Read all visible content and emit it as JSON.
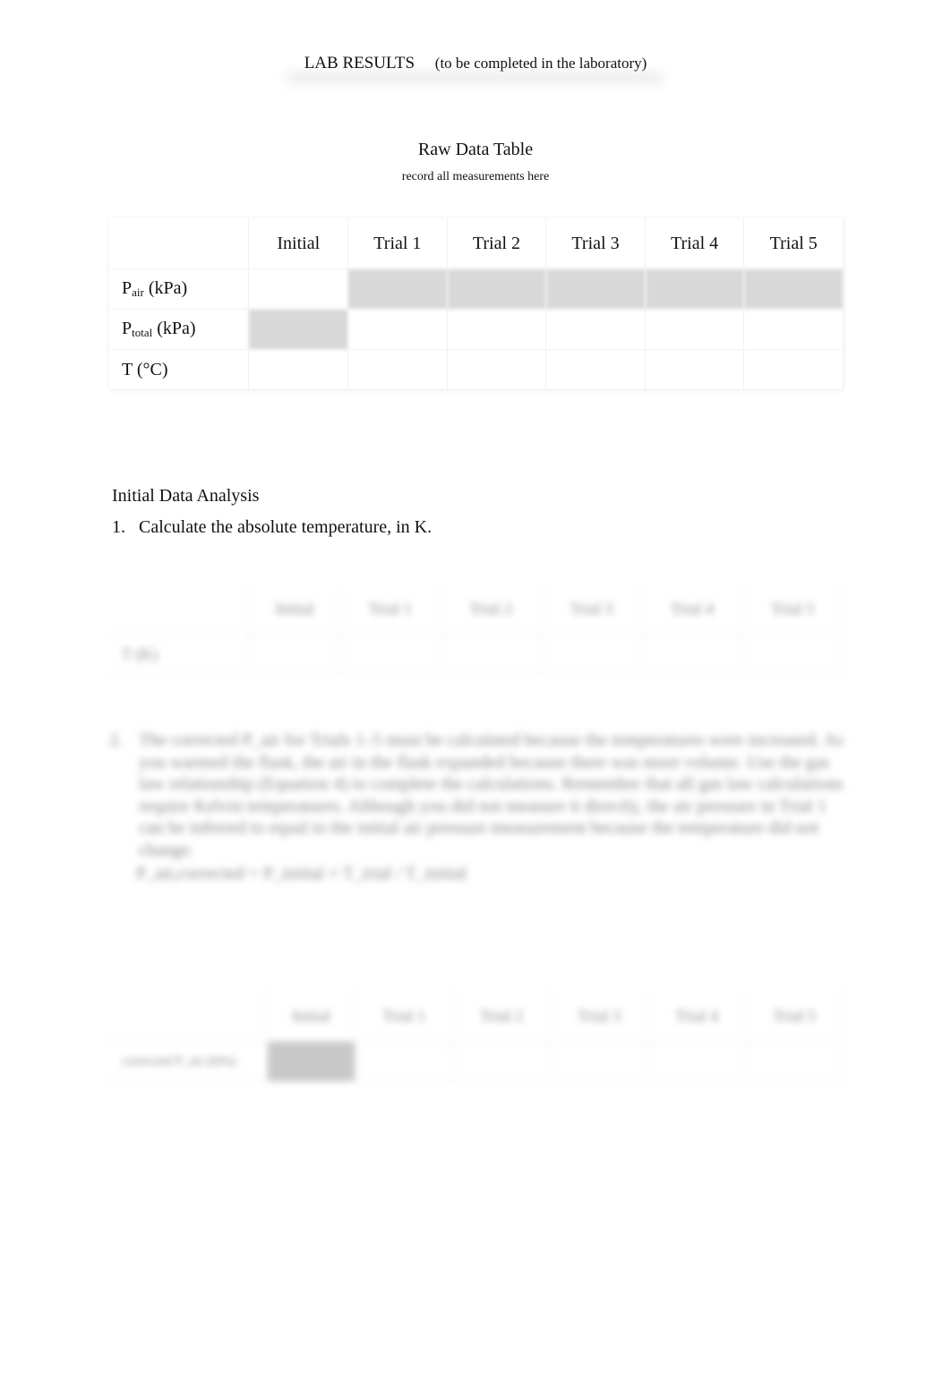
{
  "header": {
    "title": "LAB RESULTS",
    "subtitle": "(to be completed in the laboratory)"
  },
  "raw_table": {
    "title": "Raw Data Table",
    "subtitle": "record all measurements here",
    "columns": [
      "Initial",
      "Trial 1",
      "Trial 2",
      "Trial 3",
      "Trial 4",
      "Trial 5"
    ],
    "rows": [
      {
        "symbol": "P",
        "subscript": "air",
        "unit": "(kPa)",
        "shaded": [
          false,
          true,
          true,
          true,
          true,
          true
        ]
      },
      {
        "symbol": "P",
        "subscript": "total",
        "unit": "(kPa)",
        "shaded": [
          true,
          false,
          false,
          false,
          false,
          false
        ]
      },
      {
        "symbol": "T",
        "subscript": "",
        "unit": "(°C)",
        "shaded": [
          false,
          false,
          false,
          false,
          false,
          false
        ]
      }
    ]
  },
  "analysis": {
    "section_title": "Initial Data Analysis",
    "q1": {
      "number": "1.",
      "text": "Calculate the absolute temperature, in K."
    },
    "table1": {
      "columns": [
        "Initial",
        "Trial 1",
        "Trial 2",
        "Trial 3",
        "Trial 4",
        "Trial 5"
      ],
      "row_label": "T (K)"
    },
    "q2": {
      "number": "2.",
      "text": "The corrected P_air for Trials 1–5 must be calculated because the temperatures were increased. As you warmed the flask, the air in the flask expanded because there was more volume. Use the gas law relationship (Equation 4) to complete the calculations. Remember that all gas law calculations require Kelvin temperatures. Although you did not measure it directly, the air pressure in Trial 1 can be inferred to equal to the initial air pressure measurement because the temperature did not change.",
      "formula": "P_air,corrected = P_initial × T_trial / T_initial"
    },
    "table2": {
      "columns": [
        "Initial",
        "Trial 1",
        "Trial 2",
        "Trial 3",
        "Trial 4",
        "Trial 5"
      ],
      "row_label": "corrected P_air (kPa)"
    }
  }
}
